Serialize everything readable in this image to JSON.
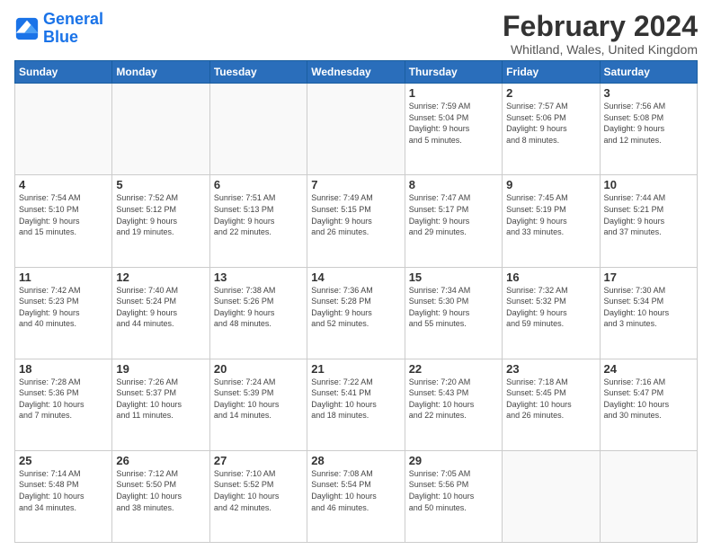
{
  "header": {
    "logo_line1": "General",
    "logo_line2": "Blue",
    "title": "February 2024",
    "subtitle": "Whitland, Wales, United Kingdom"
  },
  "days_of_week": [
    "Sunday",
    "Monday",
    "Tuesday",
    "Wednesday",
    "Thursday",
    "Friday",
    "Saturday"
  ],
  "weeks": [
    [
      {
        "day": "",
        "info": ""
      },
      {
        "day": "",
        "info": ""
      },
      {
        "day": "",
        "info": ""
      },
      {
        "day": "",
        "info": ""
      },
      {
        "day": "1",
        "info": "Sunrise: 7:59 AM\nSunset: 5:04 PM\nDaylight: 9 hours\nand 5 minutes."
      },
      {
        "day": "2",
        "info": "Sunrise: 7:57 AM\nSunset: 5:06 PM\nDaylight: 9 hours\nand 8 minutes."
      },
      {
        "day": "3",
        "info": "Sunrise: 7:56 AM\nSunset: 5:08 PM\nDaylight: 9 hours\nand 12 minutes."
      }
    ],
    [
      {
        "day": "4",
        "info": "Sunrise: 7:54 AM\nSunset: 5:10 PM\nDaylight: 9 hours\nand 15 minutes."
      },
      {
        "day": "5",
        "info": "Sunrise: 7:52 AM\nSunset: 5:12 PM\nDaylight: 9 hours\nand 19 minutes."
      },
      {
        "day": "6",
        "info": "Sunrise: 7:51 AM\nSunset: 5:13 PM\nDaylight: 9 hours\nand 22 minutes."
      },
      {
        "day": "7",
        "info": "Sunrise: 7:49 AM\nSunset: 5:15 PM\nDaylight: 9 hours\nand 26 minutes."
      },
      {
        "day": "8",
        "info": "Sunrise: 7:47 AM\nSunset: 5:17 PM\nDaylight: 9 hours\nand 29 minutes."
      },
      {
        "day": "9",
        "info": "Sunrise: 7:45 AM\nSunset: 5:19 PM\nDaylight: 9 hours\nand 33 minutes."
      },
      {
        "day": "10",
        "info": "Sunrise: 7:44 AM\nSunset: 5:21 PM\nDaylight: 9 hours\nand 37 minutes."
      }
    ],
    [
      {
        "day": "11",
        "info": "Sunrise: 7:42 AM\nSunset: 5:23 PM\nDaylight: 9 hours\nand 40 minutes."
      },
      {
        "day": "12",
        "info": "Sunrise: 7:40 AM\nSunset: 5:24 PM\nDaylight: 9 hours\nand 44 minutes."
      },
      {
        "day": "13",
        "info": "Sunrise: 7:38 AM\nSunset: 5:26 PM\nDaylight: 9 hours\nand 48 minutes."
      },
      {
        "day": "14",
        "info": "Sunrise: 7:36 AM\nSunset: 5:28 PM\nDaylight: 9 hours\nand 52 minutes."
      },
      {
        "day": "15",
        "info": "Sunrise: 7:34 AM\nSunset: 5:30 PM\nDaylight: 9 hours\nand 55 minutes."
      },
      {
        "day": "16",
        "info": "Sunrise: 7:32 AM\nSunset: 5:32 PM\nDaylight: 9 hours\nand 59 minutes."
      },
      {
        "day": "17",
        "info": "Sunrise: 7:30 AM\nSunset: 5:34 PM\nDaylight: 10 hours\nand 3 minutes."
      }
    ],
    [
      {
        "day": "18",
        "info": "Sunrise: 7:28 AM\nSunset: 5:36 PM\nDaylight: 10 hours\nand 7 minutes."
      },
      {
        "day": "19",
        "info": "Sunrise: 7:26 AM\nSunset: 5:37 PM\nDaylight: 10 hours\nand 11 minutes."
      },
      {
        "day": "20",
        "info": "Sunrise: 7:24 AM\nSunset: 5:39 PM\nDaylight: 10 hours\nand 14 minutes."
      },
      {
        "day": "21",
        "info": "Sunrise: 7:22 AM\nSunset: 5:41 PM\nDaylight: 10 hours\nand 18 minutes."
      },
      {
        "day": "22",
        "info": "Sunrise: 7:20 AM\nSunset: 5:43 PM\nDaylight: 10 hours\nand 22 minutes."
      },
      {
        "day": "23",
        "info": "Sunrise: 7:18 AM\nSunset: 5:45 PM\nDaylight: 10 hours\nand 26 minutes."
      },
      {
        "day": "24",
        "info": "Sunrise: 7:16 AM\nSunset: 5:47 PM\nDaylight: 10 hours\nand 30 minutes."
      }
    ],
    [
      {
        "day": "25",
        "info": "Sunrise: 7:14 AM\nSunset: 5:48 PM\nDaylight: 10 hours\nand 34 minutes."
      },
      {
        "day": "26",
        "info": "Sunrise: 7:12 AM\nSunset: 5:50 PM\nDaylight: 10 hours\nand 38 minutes."
      },
      {
        "day": "27",
        "info": "Sunrise: 7:10 AM\nSunset: 5:52 PM\nDaylight: 10 hours\nand 42 minutes."
      },
      {
        "day": "28",
        "info": "Sunrise: 7:08 AM\nSunset: 5:54 PM\nDaylight: 10 hours\nand 46 minutes."
      },
      {
        "day": "29",
        "info": "Sunrise: 7:05 AM\nSunset: 5:56 PM\nDaylight: 10 hours\nand 50 minutes."
      },
      {
        "day": "",
        "info": ""
      },
      {
        "day": "",
        "info": ""
      }
    ]
  ]
}
